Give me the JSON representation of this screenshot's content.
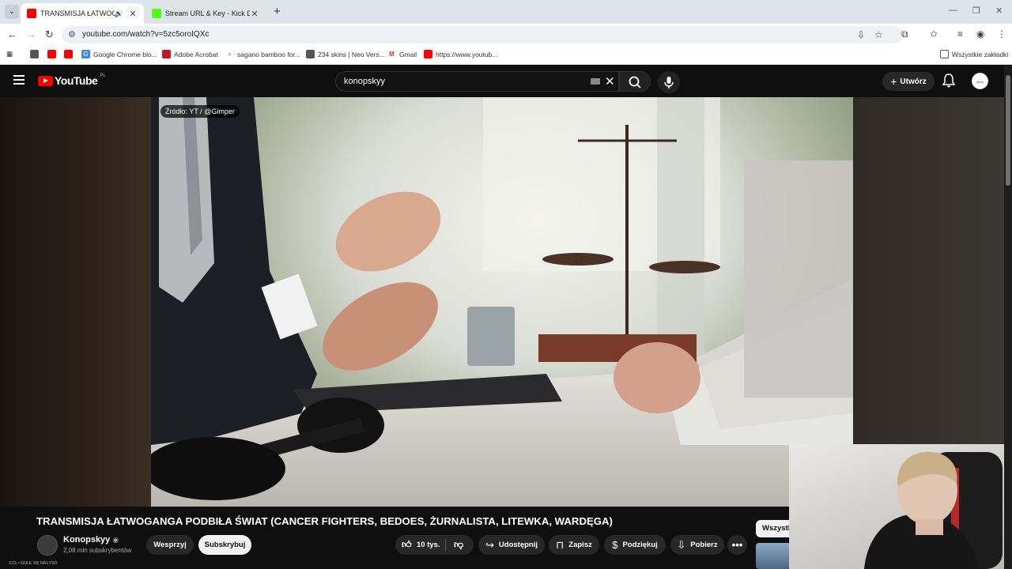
{
  "browser": {
    "tabs": [
      {
        "title": "TRANSMISJA ŁATWOGANG",
        "active": true,
        "favicon_color": "#ff0000"
      },
      {
        "title": "Stream URL & Key - Kick Dashb",
        "active": false,
        "favicon_color": "#53fc18"
      }
    ],
    "url": "youtube.com/watch?v=5zc5oroIQXc",
    "bookmarks": [
      {
        "label": "",
        "icon": "globe-icon"
      },
      {
        "label": "",
        "icon": "youtube-icon"
      },
      {
        "label": "",
        "icon": "youtube-icon"
      },
      {
        "label": "Google Chrome blo...",
        "icon": "google-icon"
      },
      {
        "label": "Adobe Acrobat",
        "icon": "acrobat-icon"
      },
      {
        "label": "sagano bamboo for...",
        "icon": "search-icon"
      },
      {
        "label": "234 skins | Neo Vers...",
        "icon": "globe-icon"
      },
      {
        "label": "Gmail",
        "icon": "gmail-icon"
      },
      {
        "label": "https://www.youtub...",
        "icon": "youtube-icon"
      }
    ],
    "all_bookmarks": "Wszystkie zakładki"
  },
  "youtube": {
    "logo_text": "YouTube",
    "country": "PL",
    "search_query": "konopskyy",
    "create_label": "Utwórz",
    "avatar_text": "łatwy"
  },
  "video": {
    "source_overlay": "Źródło: YT / @Gimper",
    "title": "TRANSMISJA ŁATWOGANGA PODBIŁA ŚWIAT (CANCER FIGHTERS, BEDOES, ŻURNALISTA, LITEWKA, WARDĘGA)",
    "channel": "Konopskyy",
    "subscribers": "2,08 mln subskrybentów",
    "buttons": {
      "support": "Wesprzyj",
      "subscribe": "Subskrybuj",
      "likes": "10 tys.",
      "share": "Udostępnij",
      "save": "Zapisz",
      "thanks": "Podziękuj",
      "download": "Pobierz"
    },
    "chip": "Wszystk",
    "bottom_caption": "CCL • GOLE SIĘ NA ŁYSO"
  }
}
